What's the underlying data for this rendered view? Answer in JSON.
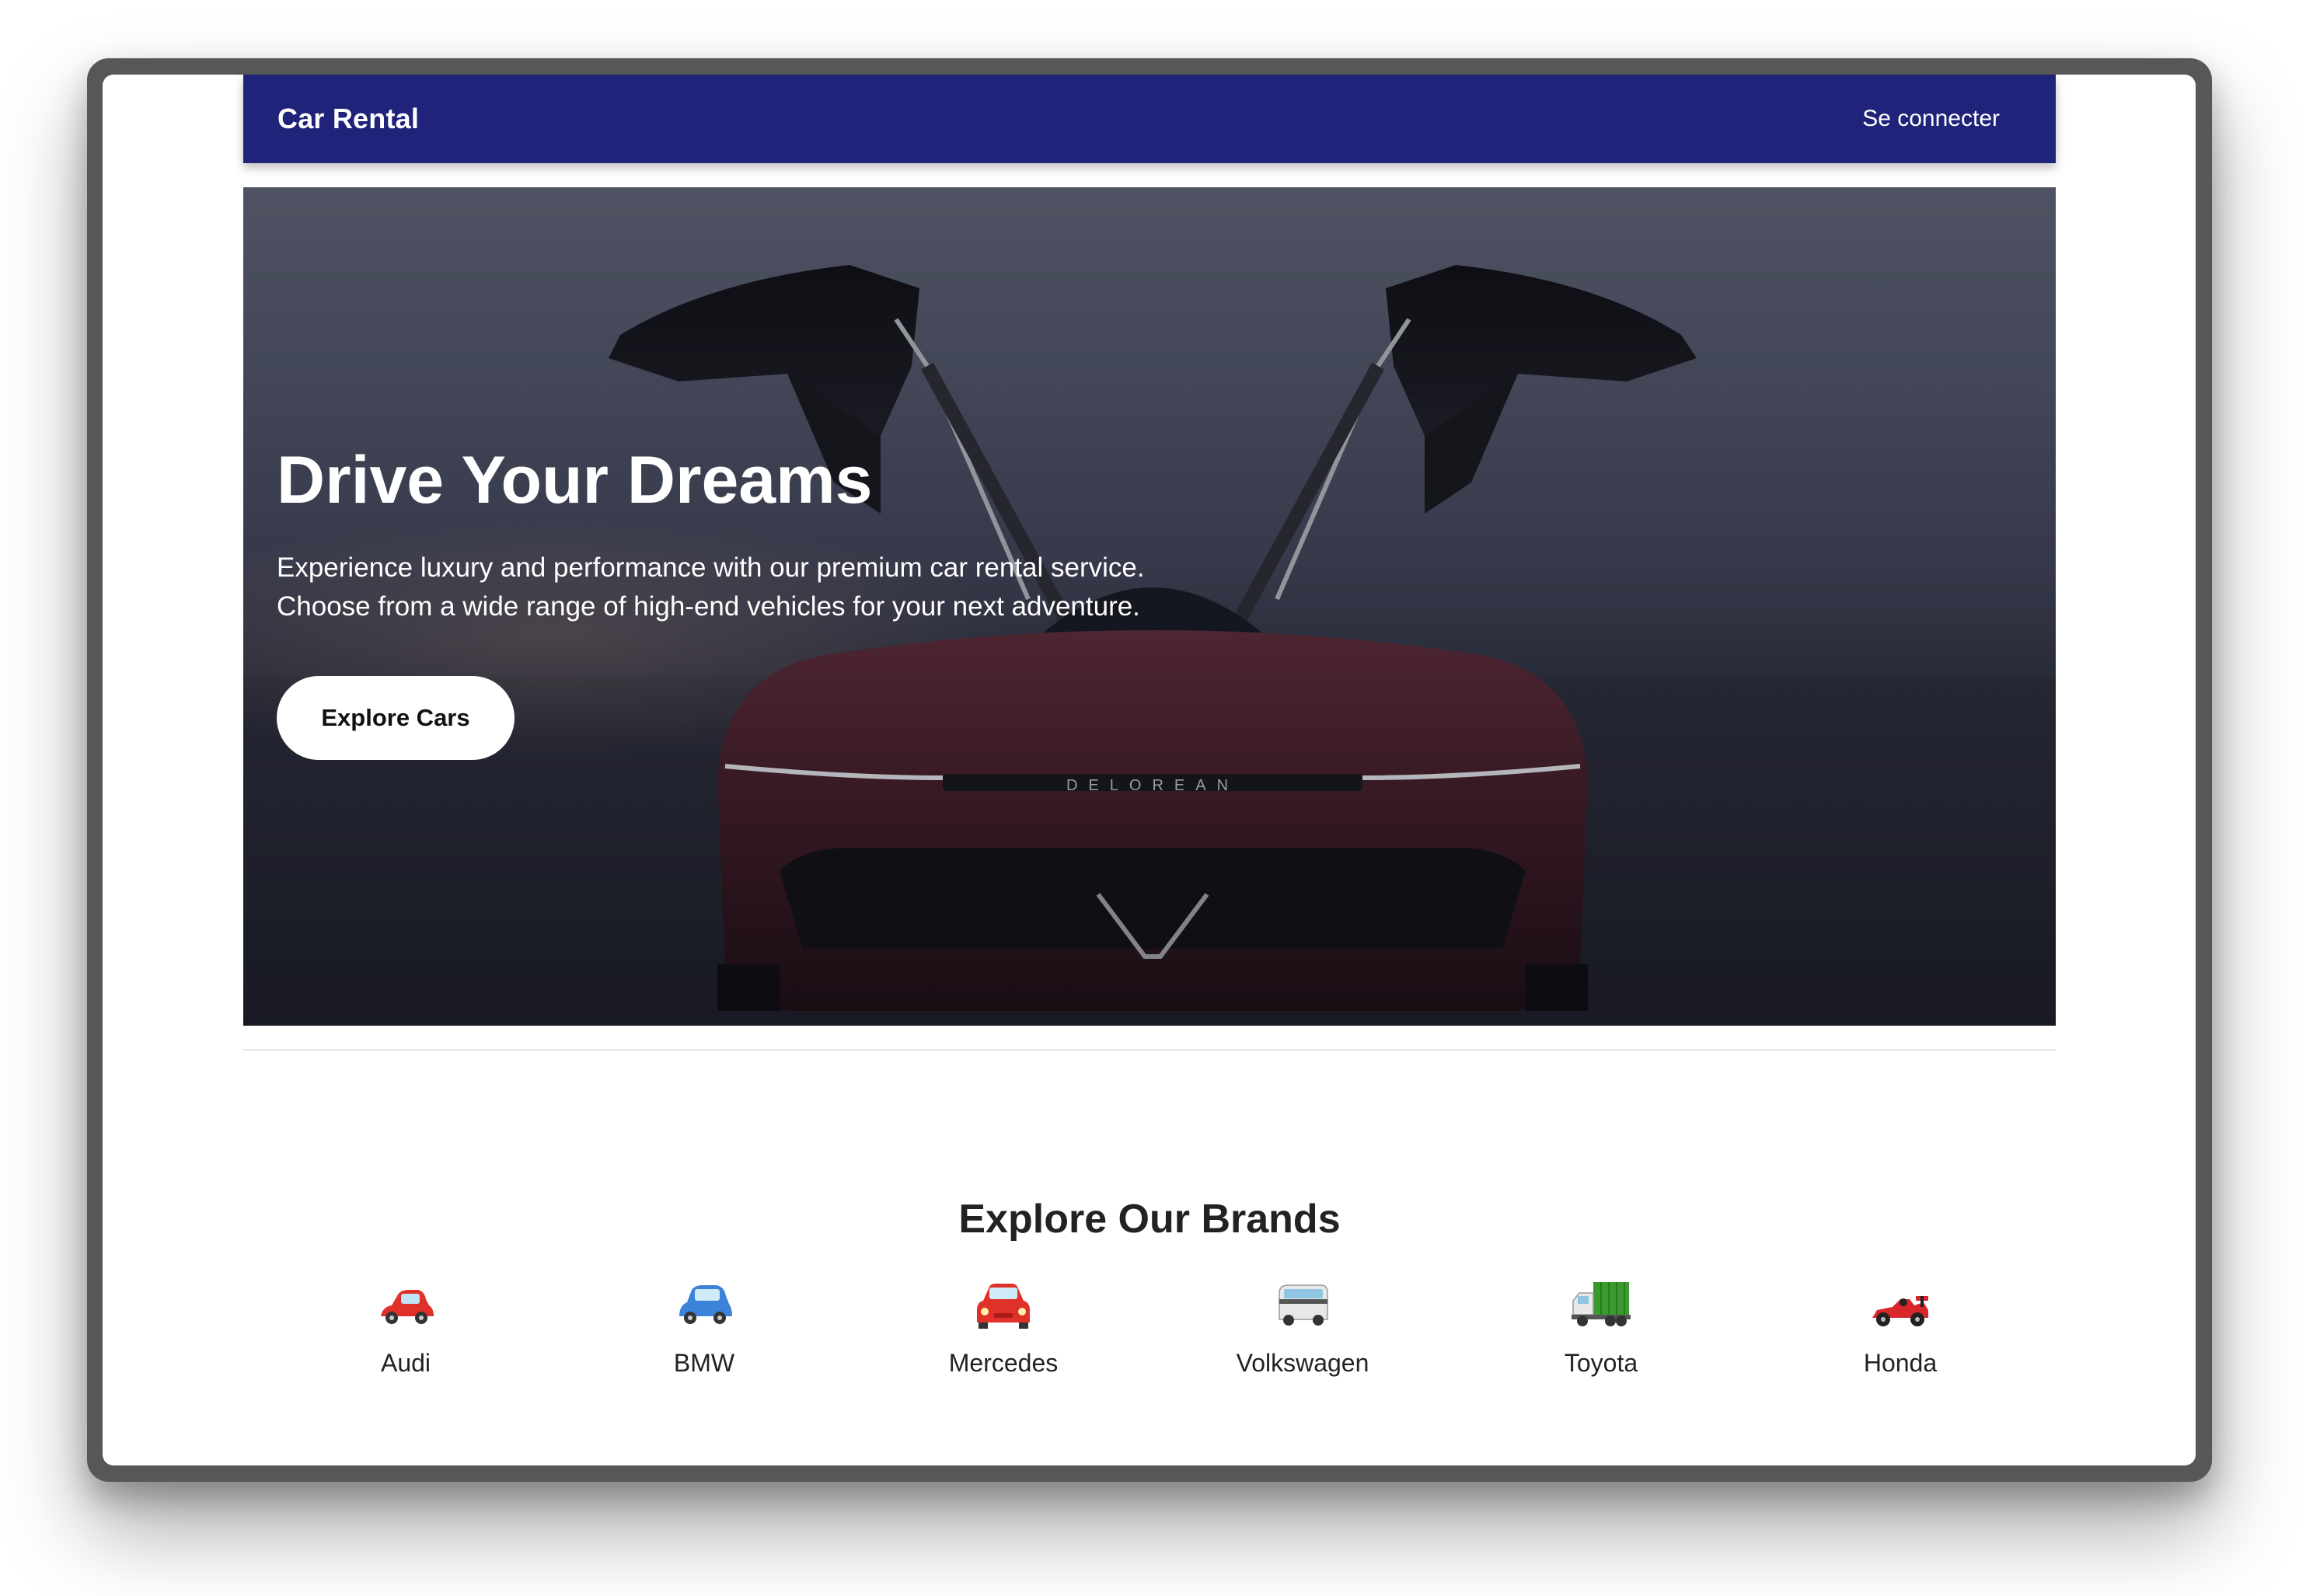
{
  "navbar": {
    "brand": "Car Rental",
    "login_label": "Se connecter"
  },
  "hero": {
    "title": "Drive Your Dreams",
    "subtitle": "Experience luxury and performance with our premium car rental service. Choose from a wide range of high-end vehicles for your next adventure.",
    "cta_label": "Explore Cars",
    "image_label": "DELOREAN"
  },
  "brands": {
    "title": "Explore Our Brands",
    "items": [
      {
        "name": "Audi",
        "icon": "red-car-icon",
        "color": "#e0302a"
      },
      {
        "name": "BMW",
        "icon": "blue-car-icon",
        "color": "#3c82d8"
      },
      {
        "name": "Mercedes",
        "icon": "red-car-front-icon",
        "color": "#e0302a"
      },
      {
        "name": "Volkswagen",
        "icon": "van-icon",
        "color": "#d9d9d9"
      },
      {
        "name": "Toyota",
        "icon": "truck-icon",
        "color": "#3a9a2d"
      },
      {
        "name": "Honda",
        "icon": "race-car-icon",
        "color": "#d8262d"
      }
    ]
  },
  "colors": {
    "navbar": "#1f237a",
    "text_dark": "#222222",
    "white": "#ffffff"
  }
}
